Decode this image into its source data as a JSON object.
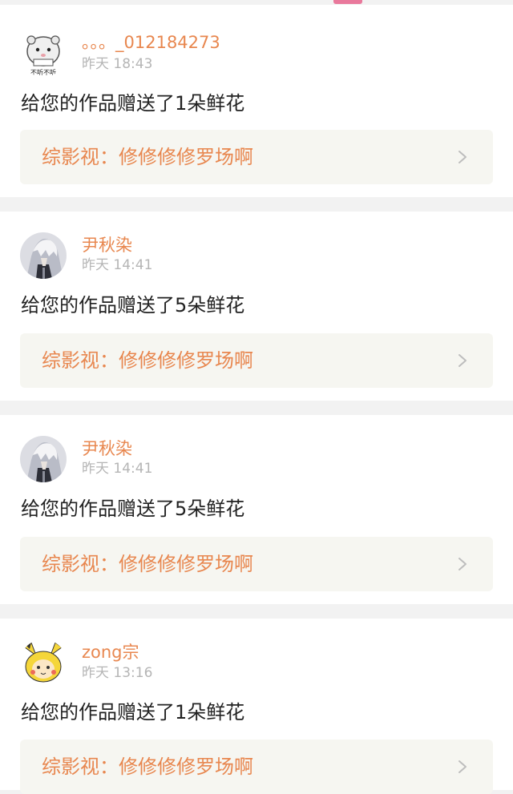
{
  "notifications": [
    {
      "username": "。。。_012184273",
      "time": "昨天 18:43",
      "message": "给您的作品赠送了1朵鲜花",
      "work": "综影视：修修修修罗场啊",
      "avatar_icon": "hamster-avatar-icon",
      "avatar_text": "不听不听"
    },
    {
      "username": "尹秋染",
      "time": "昨天 14:41",
      "message": "给您的作品赠送了5朵鲜花",
      "work": "综影视：修修修修罗场啊",
      "avatar_icon": "anime-character-avatar-icon"
    },
    {
      "username": "尹秋染",
      "time": "昨天 14:41",
      "message": "给您的作品赠送了5朵鲜花",
      "work": "综影视：修修修修罗场啊",
      "avatar_icon": "anime-character-avatar-icon"
    },
    {
      "username": "zong宗",
      "time": "昨天 13:16",
      "message": "给您的作品赠送了1朵鲜花",
      "work": "综影视：修修修修罗场啊",
      "avatar_icon": "pikachu-costume-avatar-icon"
    }
  ],
  "colors": {
    "accent_orange": "#e8874f",
    "tab_indicator_pink": "#e9799c",
    "timestamp_gray": "#b5b5b5",
    "link_box_bg": "#f6f6f1",
    "separator_bg": "#f2f2f2"
  }
}
